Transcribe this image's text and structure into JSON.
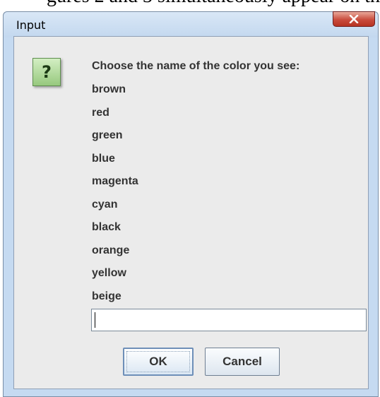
{
  "background_text": "gures 2 and 3 simultaneously appear on th",
  "window": {
    "title": "Input",
    "close_label": "X"
  },
  "dialog": {
    "icon": "question-icon",
    "icon_glyph": "?",
    "prompt": "Choose the name of the color you see:",
    "options": [
      "brown",
      "red",
      "green",
      "blue",
      "magenta",
      "cyan",
      "black",
      "orange",
      "yellow",
      "beige"
    ],
    "input": {
      "value": "",
      "placeholder": ""
    },
    "buttons": {
      "ok": "OK",
      "cancel": "Cancel"
    }
  },
  "colors": {
    "icon_green": "#97c97e",
    "close_red": "#c94b3c",
    "frame_blue": "#c5daf1"
  }
}
